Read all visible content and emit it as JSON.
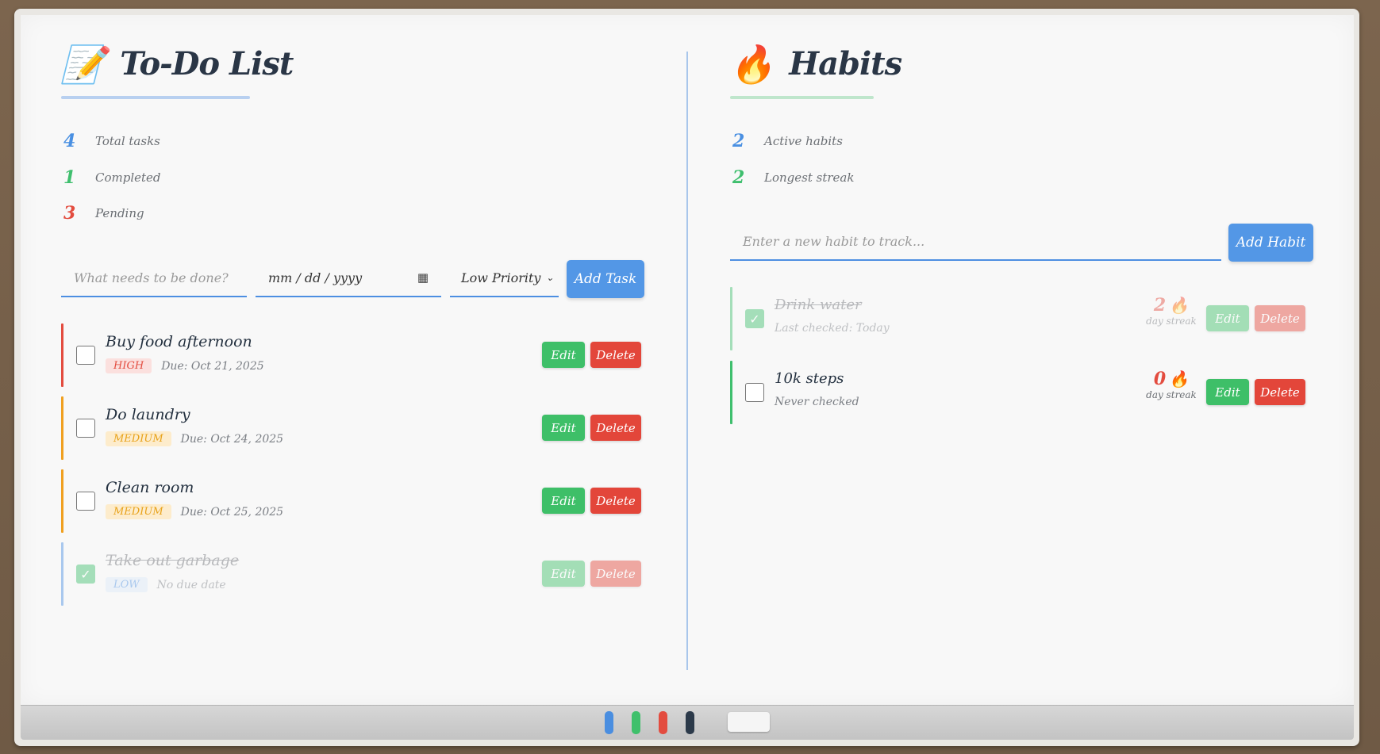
{
  "todo": {
    "title": "To-Do List",
    "title_icon": "memo-pencil-icon",
    "stats": [
      {
        "value": "4",
        "label": "Total tasks",
        "color": "#4a90e2"
      },
      {
        "value": "1",
        "label": "Completed",
        "color": "#3fbf6e"
      },
      {
        "value": "3",
        "label": "Pending",
        "color": "#e34c3f"
      }
    ],
    "input_placeholder": "What needs to be done?",
    "date_placeholder": "mm / dd / yyyy",
    "priority_selected": "Low Priority",
    "add_button": "Add Task",
    "tasks": [
      {
        "name": "Buy food afternoon",
        "priority": "HIGH",
        "due": "Due: Oct 21, 2025",
        "done": false,
        "edit": "Edit",
        "delete": "Delete"
      },
      {
        "name": "Do laundry",
        "priority": "MEDIUM",
        "due": "Due: Oct 24, 2025",
        "done": false,
        "edit": "Edit",
        "delete": "Delete"
      },
      {
        "name": "Clean room",
        "priority": "MEDIUM",
        "due": "Due: Oct 25, 2025",
        "done": false,
        "edit": "Edit",
        "delete": "Delete"
      },
      {
        "name": "Take out garbage",
        "priority": "LOW",
        "due": "No due date",
        "done": true,
        "edit": "Edit",
        "delete": "Delete"
      }
    ]
  },
  "habits": {
    "title": "Habits",
    "title_icon": "fire-icon",
    "stats": [
      {
        "value": "2",
        "label": "Active habits",
        "color": "#4a90e2"
      },
      {
        "value": "2",
        "label": "Longest streak",
        "color": "#3fbf6e"
      }
    ],
    "input_placeholder": "Enter a new habit to track...",
    "add_button": "Add Habit",
    "items": [
      {
        "name": "Drink water",
        "status": "Last checked: Today",
        "streak": "2",
        "streak_label": "day streak",
        "done": true,
        "edit": "Edit",
        "delete": "Delete"
      },
      {
        "name": "10k steps",
        "status": "Never checked",
        "streak": "0",
        "streak_label": "day streak",
        "done": false,
        "edit": "Edit",
        "delete": "Delete"
      }
    ]
  },
  "colors": {
    "high": "#e34c3f",
    "medium": "#f0a020",
    "low": "#a9c6eb",
    "primary": "#5397e6",
    "edit": "#3ebf68",
    "delete": "#e3463a"
  }
}
